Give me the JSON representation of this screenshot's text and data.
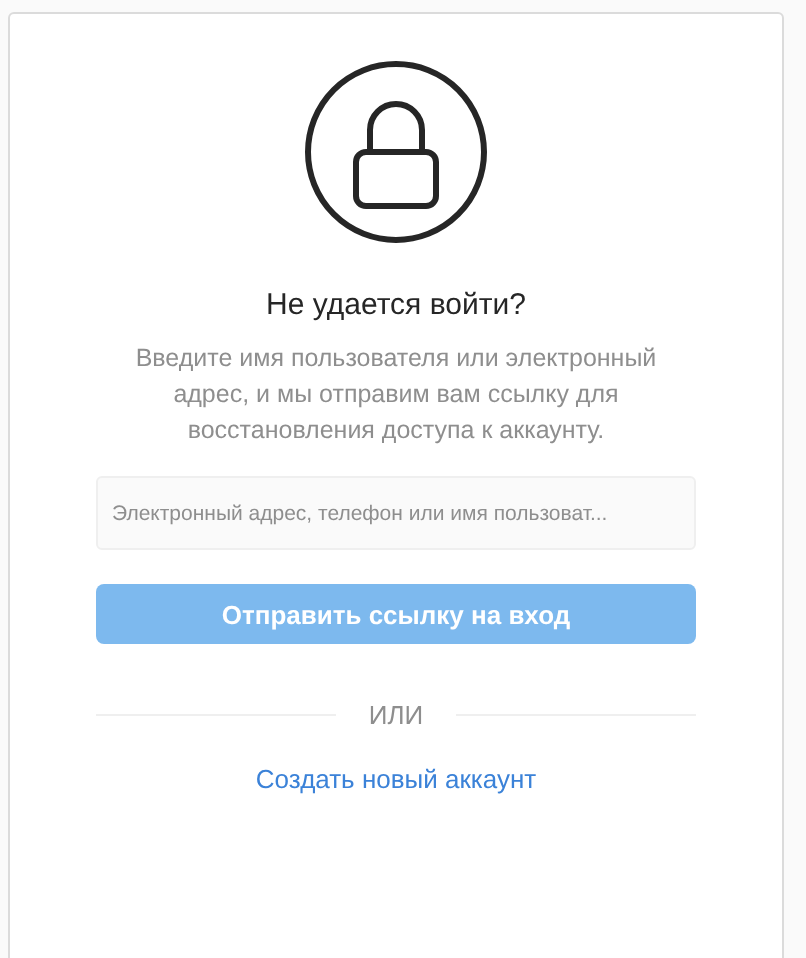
{
  "title": "Не удается войти?",
  "description": "Введите имя пользователя или электронный адрес, и мы отправим вам ссылку для восстановления доступа к аккаунту.",
  "field": {
    "placeholder": "Электронный адрес, телефон или имя пользоват..."
  },
  "submit_button": {
    "label": "Отправить ссылку на вход",
    "disabled": true
  },
  "divider_text": "ИЛИ",
  "create_account_link": "Создать новый аккаунт"
}
